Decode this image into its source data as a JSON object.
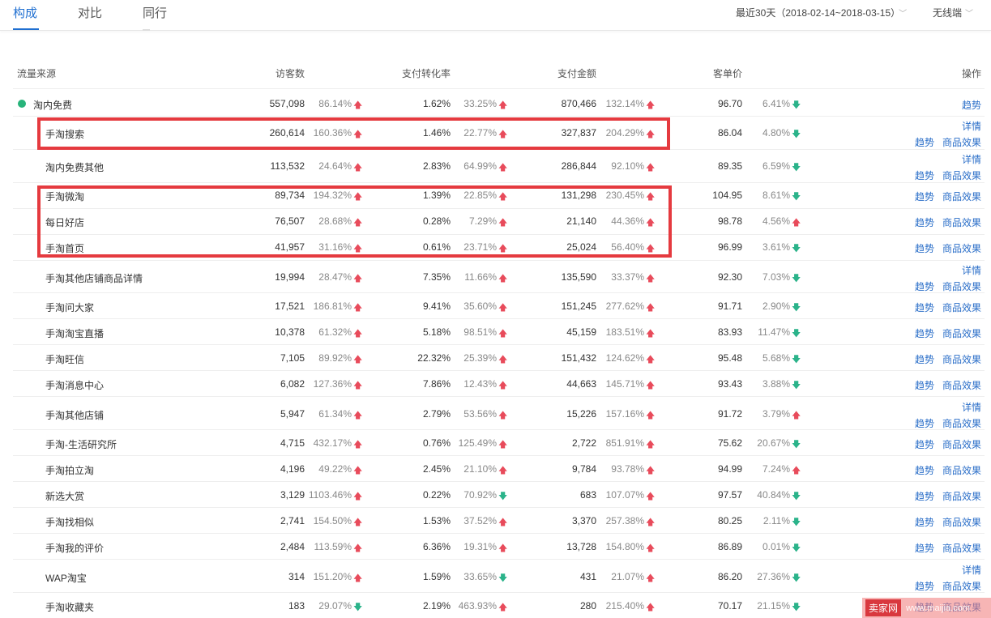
{
  "tabs": [
    {
      "label": "构成",
      "active": true
    },
    {
      "label": "对比",
      "active": false
    },
    {
      "label": "同行",
      "active": false
    }
  ],
  "date_range": "最近30天（2018-02-14~2018-03-15）",
  "device": "无线端",
  "columns": {
    "source": "流量来源",
    "visitors": "访客数",
    "conversion": "支付转化率",
    "amount": "支付金额",
    "unit_price": "客单价",
    "actions": "操作"
  },
  "colors": {
    "up": "#e84b5b",
    "down": "#2bb38a",
    "link": "#2a6ec8",
    "highlight": "#e53a3f",
    "tab_active": "#1f6fd1"
  },
  "rows": [
    {
      "name": "淘内免费",
      "group": true,
      "visitors": "557,098",
      "visitors_pct": "86.14%",
      "visitors_dir": "up",
      "conv": "1.62%",
      "conv_pct": "33.25%",
      "conv_dir": "up",
      "amount": "870,466",
      "amount_pct": "132.14%",
      "amount_dir": "up",
      "price": "96.70",
      "price_pct": "6.41%",
      "price_dir": "down",
      "actions": [
        "趋势"
      ],
      "detail": false
    },
    {
      "name": "手淘搜索",
      "visitors": "260,614",
      "visitors_pct": "160.36%",
      "visitors_dir": "up",
      "conv": "1.46%",
      "conv_pct": "22.77%",
      "conv_dir": "up",
      "amount": "327,837",
      "amount_pct": "204.29%",
      "amount_dir": "up",
      "price": "86.04",
      "price_pct": "4.80%",
      "price_dir": "down",
      "actions": [
        "趋势",
        "商品效果"
      ],
      "detail": true
    },
    {
      "name": "淘内免费其他",
      "visitors": "113,532",
      "visitors_pct": "24.64%",
      "visitors_dir": "up",
      "conv": "2.83%",
      "conv_pct": "64.99%",
      "conv_dir": "up",
      "amount": "286,844",
      "amount_pct": "92.10%",
      "amount_dir": "up",
      "price": "89.35",
      "price_pct": "6.59%",
      "price_dir": "down",
      "actions": [
        "趋势",
        "商品效果"
      ],
      "detail": true
    },
    {
      "name": "手淘微淘",
      "visitors": "89,734",
      "visitors_pct": "194.32%",
      "visitors_dir": "up",
      "conv": "1.39%",
      "conv_pct": "22.85%",
      "conv_dir": "up",
      "amount": "131,298",
      "amount_pct": "230.45%",
      "amount_dir": "up",
      "price": "104.95",
      "price_pct": "8.61%",
      "price_dir": "down",
      "actions": [
        "趋势",
        "商品效果"
      ],
      "detail": false
    },
    {
      "name": "每日好店",
      "visitors": "76,507",
      "visitors_pct": "28.68%",
      "visitors_dir": "up",
      "conv": "0.28%",
      "conv_pct": "7.29%",
      "conv_dir": "up",
      "amount": "21,140",
      "amount_pct": "44.36%",
      "amount_dir": "up",
      "price": "98.78",
      "price_pct": "4.56%",
      "price_dir": "up",
      "actions": [
        "趋势",
        "商品效果"
      ],
      "detail": false
    },
    {
      "name": "手淘首页",
      "visitors": "41,957",
      "visitors_pct": "31.16%",
      "visitors_dir": "up",
      "conv": "0.61%",
      "conv_pct": "23.71%",
      "conv_dir": "up",
      "amount": "25,024",
      "amount_pct": "56.40%",
      "amount_dir": "up",
      "price": "96.99",
      "price_pct": "3.61%",
      "price_dir": "down",
      "actions": [
        "趋势",
        "商品效果"
      ],
      "detail": false
    },
    {
      "name": "手淘其他店铺商品详情",
      "visitors": "19,994",
      "visitors_pct": "28.47%",
      "visitors_dir": "up",
      "conv": "7.35%",
      "conv_pct": "11.66%",
      "conv_dir": "up",
      "amount": "135,590",
      "amount_pct": "33.37%",
      "amount_dir": "up",
      "price": "92.30",
      "price_pct": "7.03%",
      "price_dir": "down",
      "actions": [
        "趋势",
        "商品效果"
      ],
      "detail": true
    },
    {
      "name": "手淘问大家",
      "visitors": "17,521",
      "visitors_pct": "186.81%",
      "visitors_dir": "up",
      "conv": "9.41%",
      "conv_pct": "35.60%",
      "conv_dir": "up",
      "amount": "151,245",
      "amount_pct": "277.62%",
      "amount_dir": "up",
      "price": "91.71",
      "price_pct": "2.90%",
      "price_dir": "down",
      "actions": [
        "趋势",
        "商品效果"
      ],
      "detail": false
    },
    {
      "name": "手淘淘宝直播",
      "visitors": "10,378",
      "visitors_pct": "61.32%",
      "visitors_dir": "up",
      "conv": "5.18%",
      "conv_pct": "98.51%",
      "conv_dir": "up",
      "amount": "45,159",
      "amount_pct": "183.51%",
      "amount_dir": "up",
      "price": "83.93",
      "price_pct": "11.47%",
      "price_dir": "down",
      "actions": [
        "趋势",
        "商品效果"
      ],
      "detail": false
    },
    {
      "name": "手淘旺信",
      "visitors": "7,105",
      "visitors_pct": "89.92%",
      "visitors_dir": "up",
      "conv": "22.32%",
      "conv_pct": "25.39%",
      "conv_dir": "up",
      "amount": "151,432",
      "amount_pct": "124.62%",
      "amount_dir": "up",
      "price": "95.48",
      "price_pct": "5.68%",
      "price_dir": "down",
      "actions": [
        "趋势",
        "商品效果"
      ],
      "detail": false
    },
    {
      "name": "手淘消息中心",
      "visitors": "6,082",
      "visitors_pct": "127.36%",
      "visitors_dir": "up",
      "conv": "7.86%",
      "conv_pct": "12.43%",
      "conv_dir": "up",
      "amount": "44,663",
      "amount_pct": "145.71%",
      "amount_dir": "up",
      "price": "93.43",
      "price_pct": "3.88%",
      "price_dir": "down",
      "actions": [
        "趋势",
        "商品效果"
      ],
      "detail": false
    },
    {
      "name": "手淘其他店铺",
      "visitors": "5,947",
      "visitors_pct": "61.34%",
      "visitors_dir": "up",
      "conv": "2.79%",
      "conv_pct": "53.56%",
      "conv_dir": "up",
      "amount": "15,226",
      "amount_pct": "157.16%",
      "amount_dir": "up",
      "price": "91.72",
      "price_pct": "3.79%",
      "price_dir": "up",
      "actions": [
        "趋势",
        "商品效果"
      ],
      "detail": true
    },
    {
      "name": "手淘-生活研究所",
      "visitors": "4,715",
      "visitors_pct": "432.17%",
      "visitors_dir": "up",
      "conv": "0.76%",
      "conv_pct": "125.49%",
      "conv_dir": "up",
      "amount": "2,722",
      "amount_pct": "851.91%",
      "amount_dir": "up",
      "price": "75.62",
      "price_pct": "20.67%",
      "price_dir": "down",
      "actions": [
        "趋势",
        "商品效果"
      ],
      "detail": false
    },
    {
      "name": "手淘拍立淘",
      "visitors": "4,196",
      "visitors_pct": "49.22%",
      "visitors_dir": "up",
      "conv": "2.45%",
      "conv_pct": "21.10%",
      "conv_dir": "up",
      "amount": "9,784",
      "amount_pct": "93.78%",
      "amount_dir": "up",
      "price": "94.99",
      "price_pct": "7.24%",
      "price_dir": "up",
      "actions": [
        "趋势",
        "商品效果"
      ],
      "detail": false
    },
    {
      "name": "新选大赏",
      "visitors": "3,129",
      "visitors_pct": "1103.46%",
      "visitors_dir": "up",
      "conv": "0.22%",
      "conv_pct": "70.92%",
      "conv_dir": "down",
      "amount": "683",
      "amount_pct": "107.07%",
      "amount_dir": "up",
      "price": "97.57",
      "price_pct": "40.84%",
      "price_dir": "down",
      "actions": [
        "趋势",
        "商品效果"
      ],
      "detail": false
    },
    {
      "name": "手淘找相似",
      "visitors": "2,741",
      "visitors_pct": "154.50%",
      "visitors_dir": "up",
      "conv": "1.53%",
      "conv_pct": "37.52%",
      "conv_dir": "up",
      "amount": "3,370",
      "amount_pct": "257.38%",
      "amount_dir": "up",
      "price": "80.25",
      "price_pct": "2.11%",
      "price_dir": "down",
      "actions": [
        "趋势",
        "商品效果"
      ],
      "detail": false
    },
    {
      "name": "手淘我的评价",
      "visitors": "2,484",
      "visitors_pct": "113.59%",
      "visitors_dir": "up",
      "conv": "6.36%",
      "conv_pct": "19.31%",
      "conv_dir": "up",
      "amount": "13,728",
      "amount_pct": "154.80%",
      "amount_dir": "up",
      "price": "86.89",
      "price_pct": "0.01%",
      "price_dir": "down",
      "actions": [
        "趋势",
        "商品效果"
      ],
      "detail": false
    },
    {
      "name": "WAP淘宝",
      "visitors": "314",
      "visitors_pct": "151.20%",
      "visitors_dir": "up",
      "conv": "1.59%",
      "conv_pct": "33.65%",
      "conv_dir": "down",
      "amount": "431",
      "amount_pct": "21.07%",
      "amount_dir": "up",
      "price": "86.20",
      "price_pct": "27.36%",
      "price_dir": "down",
      "actions": [
        "趋势",
        "商品效果"
      ],
      "detail": true
    },
    {
      "name": "手淘收藏夹",
      "visitors": "183",
      "visitors_pct": "29.07%",
      "visitors_dir": "down",
      "conv": "2.19%",
      "conv_pct": "463.93%",
      "conv_dir": "up",
      "amount": "280",
      "amount_pct": "215.40%",
      "amount_dir": "up",
      "price": "70.17",
      "price_pct": "21.15%",
      "price_dir": "down",
      "actions": [
        "趋势",
        "商品效果"
      ],
      "detail": false
    }
  ],
  "detail_label": "详情",
  "arrows": {
    "up": "🡅",
    "down": "🡇"
  },
  "watermark": {
    "logo": "卖家网",
    "url": "www.maijia.com"
  }
}
